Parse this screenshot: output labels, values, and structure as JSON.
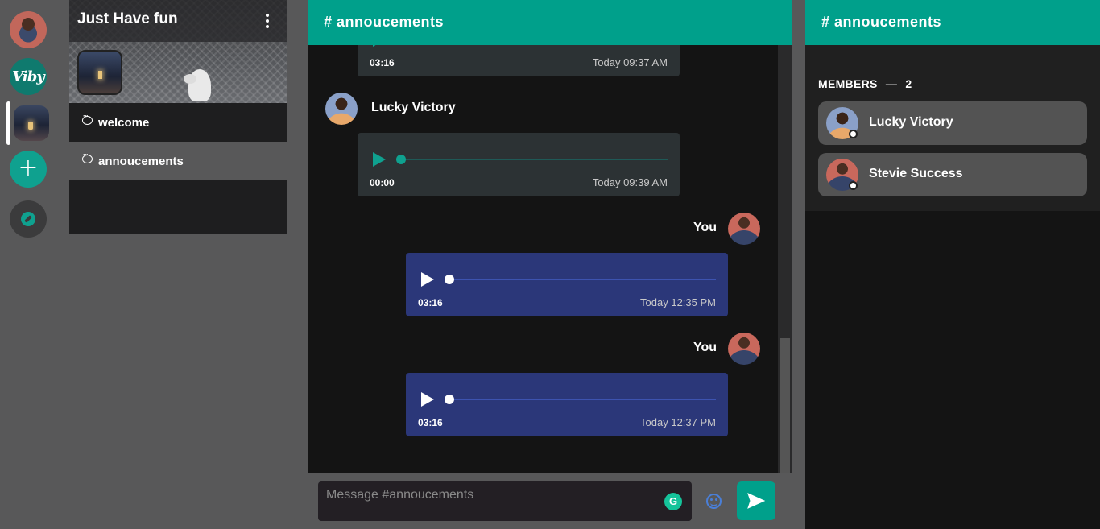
{
  "rail": {
    "servers": [
      {
        "name": "user-avatar"
      },
      {
        "name": "Viby",
        "label": "Viby"
      },
      {
        "name": "Just Have fun",
        "active": true
      }
    ],
    "add_symbol": "+",
    "explore_icon": "compass-icon"
  },
  "server": {
    "title": "Just Have fun",
    "channels": [
      {
        "label": "welcome",
        "icon": "chat-bubble-icon"
      },
      {
        "label": "annoucements",
        "icon": "chat-bubble-icon"
      }
    ]
  },
  "chat": {
    "title": "# annoucements",
    "messages": [
      {
        "sender": "",
        "duration": "03:16",
        "time": "Today 09:37 AM",
        "mine": false
      },
      {
        "sender": "Lucky Victory",
        "duration": "00:00",
        "time": "Today 09:39 AM",
        "mine": false
      },
      {
        "sender": "You",
        "duration": "03:16",
        "time": "Today 12:35 PM",
        "mine": true
      },
      {
        "sender": "You",
        "duration": "03:16",
        "time": "Today 12:37 PM",
        "mine": true
      }
    ],
    "composer": {
      "placeholder": "Message #annoucements"
    }
  },
  "members_panel": {
    "title": "# annoucements",
    "label": "MEMBERS",
    "separator": "—",
    "count": "2",
    "members": [
      {
        "name": "Lucky Victory"
      },
      {
        "name": "Stevie Success"
      }
    ]
  },
  "colors": {
    "accent": "#00a08b",
    "my_message": "#2b3779",
    "other_message": "#2c3234"
  }
}
